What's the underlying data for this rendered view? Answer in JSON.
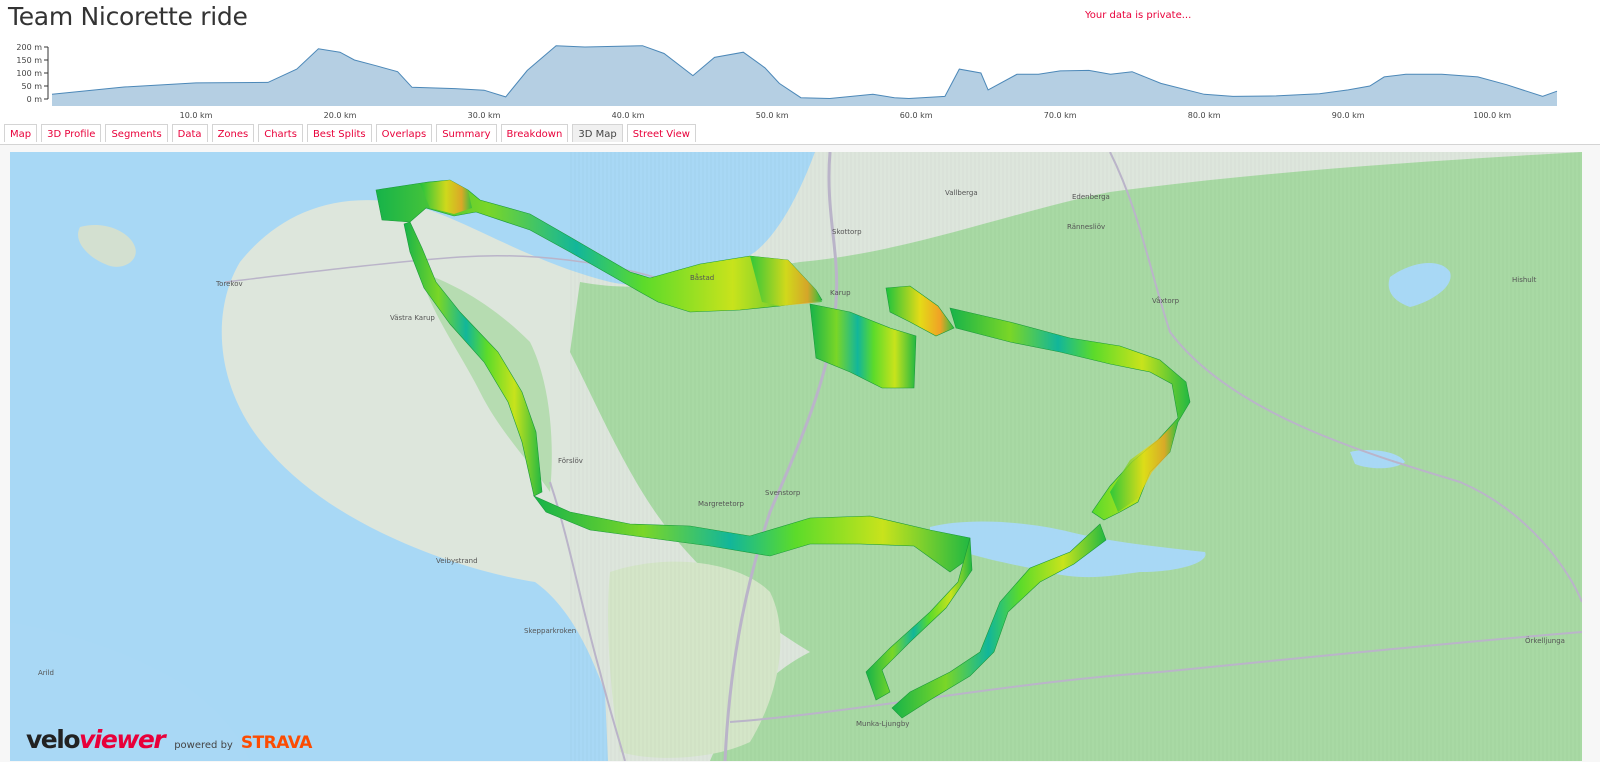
{
  "page": {
    "title": "Team Nicorette ride",
    "privacy_notice": "Your data is private..."
  },
  "elevation_profile": {
    "y_ticks": [
      "200 m",
      "150 m",
      "100 m",
      "50 m",
      "0 m"
    ],
    "x_ticks": [
      "10.0 km",
      "20.0 km",
      "30.0 km",
      "40.0 km",
      "50.0 km",
      "60.0 km",
      "70.0 km",
      "80.0 km",
      "90.0 km",
      "100.0 km"
    ],
    "elevations_m": [
      [
        0,
        18
      ],
      [
        5,
        46
      ],
      [
        10,
        62
      ],
      [
        15,
        64
      ],
      [
        17,
        115
      ],
      [
        18.5,
        193
      ],
      [
        20,
        180
      ],
      [
        21,
        150
      ],
      [
        22.5,
        128
      ],
      [
        24,
        105
      ],
      [
        25,
        45
      ],
      [
        28,
        40
      ],
      [
        30,
        34
      ],
      [
        31.5,
        8
      ],
      [
        33,
        110
      ],
      [
        35,
        205
      ],
      [
        37,
        200
      ],
      [
        41,
        205
      ],
      [
        42.5,
        175
      ],
      [
        44.5,
        90
      ],
      [
        46,
        160
      ],
      [
        48,
        180
      ],
      [
        49.5,
        120
      ],
      [
        50.5,
        60
      ],
      [
        52,
        5
      ],
      [
        54,
        2
      ],
      [
        57,
        18
      ],
      [
        58.5,
        5
      ],
      [
        59.5,
        2
      ],
      [
        62,
        10
      ],
      [
        63,
        115
      ],
      [
        64.5,
        100
      ],
      [
        65,
        35
      ],
      [
        67,
        95
      ],
      [
        68.5,
        95
      ],
      [
        70,
        108
      ],
      [
        72,
        110
      ],
      [
        73.5,
        95
      ],
      [
        75,
        105
      ],
      [
        77,
        60
      ],
      [
        80,
        18
      ],
      [
        82,
        10
      ],
      [
        85,
        12
      ],
      [
        88,
        20
      ],
      [
        90,
        35
      ],
      [
        91.5,
        50
      ],
      [
        92.5,
        85
      ],
      [
        94,
        95
      ],
      [
        96.5,
        95
      ],
      [
        99,
        85
      ],
      [
        101,
        55
      ],
      [
        102.5,
        28
      ],
      [
        103.5,
        10
      ],
      [
        104.5,
        30
      ]
    ],
    "y_max": 200,
    "x_max": 104.5
  },
  "tabs": [
    {
      "label": "Map",
      "active": false
    },
    {
      "label": "3D Profile",
      "active": false
    },
    {
      "label": "Segments",
      "active": false
    },
    {
      "label": "Data",
      "active": false
    },
    {
      "label": "Zones",
      "active": false
    },
    {
      "label": "Charts",
      "active": false
    },
    {
      "label": "Best Splits",
      "active": false
    },
    {
      "label": "Overlaps",
      "active": false
    },
    {
      "label": "Summary",
      "active": false
    },
    {
      "label": "Breakdown",
      "active": false
    },
    {
      "label": "3D Map",
      "active": true
    },
    {
      "label": "Street View",
      "active": false
    }
  ],
  "map": {
    "places": [
      "Torekov",
      "Västra Karup",
      "Förslöv",
      "Margretetorp",
      "Svenstorp",
      "Båstad",
      "Skottorp",
      "Karup",
      "Vallberga",
      "Edenberga",
      "Rännesliöv",
      "Våxtorp",
      "Hishult",
      "Veibystrand",
      "Skepparkroken",
      "Arild",
      "Munka-Ljungby",
      "Örkelljunga"
    ]
  },
  "branding": {
    "velo": "velo",
    "viewer": "viewer",
    "powered_by": "powered by",
    "strava": "STRAVA"
  },
  "colors": {
    "accent": "#e8003a",
    "sea": "#a8d8f5",
    "forest": "#a8d9a4",
    "land": "#dde6dc",
    "profile_fill": "#b5cfe3",
    "profile_line": "#4c88b8"
  }
}
